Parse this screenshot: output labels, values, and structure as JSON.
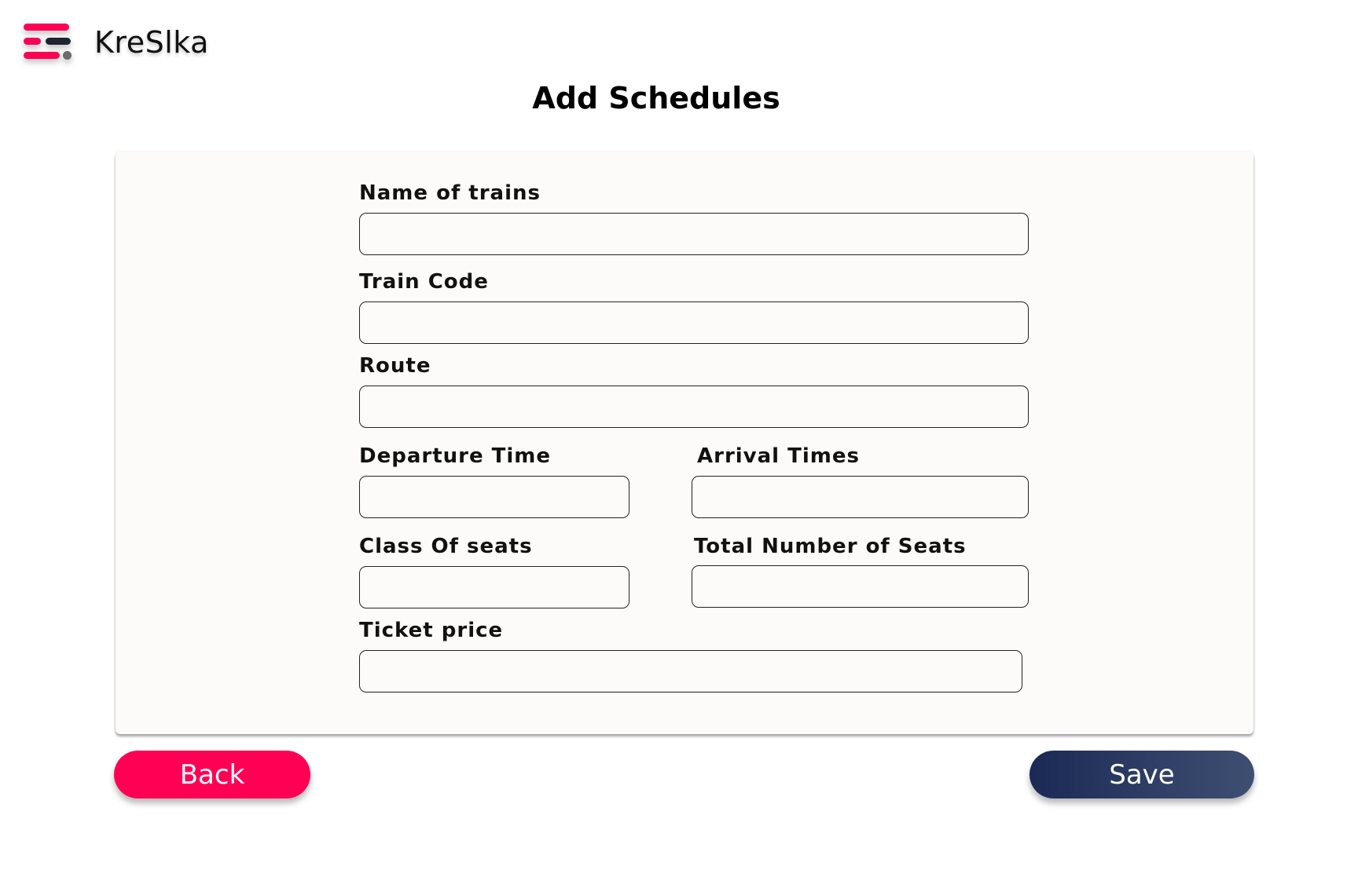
{
  "brand": {
    "name": "KreSlka",
    "colors": {
      "primary": "#ff0055",
      "dark": "#1f2433",
      "accent_dot": "#6b6b6b"
    }
  },
  "page": {
    "title": "Add Schedules"
  },
  "form": {
    "fields": [
      {
        "id": "train_name",
        "label": "Name of trains",
        "value": ""
      },
      {
        "id": "train_code",
        "label": "Train Code",
        "value": ""
      },
      {
        "id": "route",
        "label": "Route",
        "value": ""
      },
      {
        "id": "departure_time",
        "label": "Departure Time",
        "value": ""
      },
      {
        "id": "arrival_times",
        "label": "Arrival Times",
        "value": ""
      },
      {
        "id": "seat_class",
        "label": "Class Of seats",
        "value": ""
      },
      {
        "id": "total_seats",
        "label": "Total Number of Seats",
        "value": ""
      },
      {
        "id": "ticket_price",
        "label": "Ticket price",
        "value": ""
      }
    ]
  },
  "actions": {
    "back_label": "Back",
    "save_label": "Save",
    "back_color": "#ff0055",
    "save_color_start": "#1a2a55",
    "save_color_end": "#3f4f72"
  }
}
